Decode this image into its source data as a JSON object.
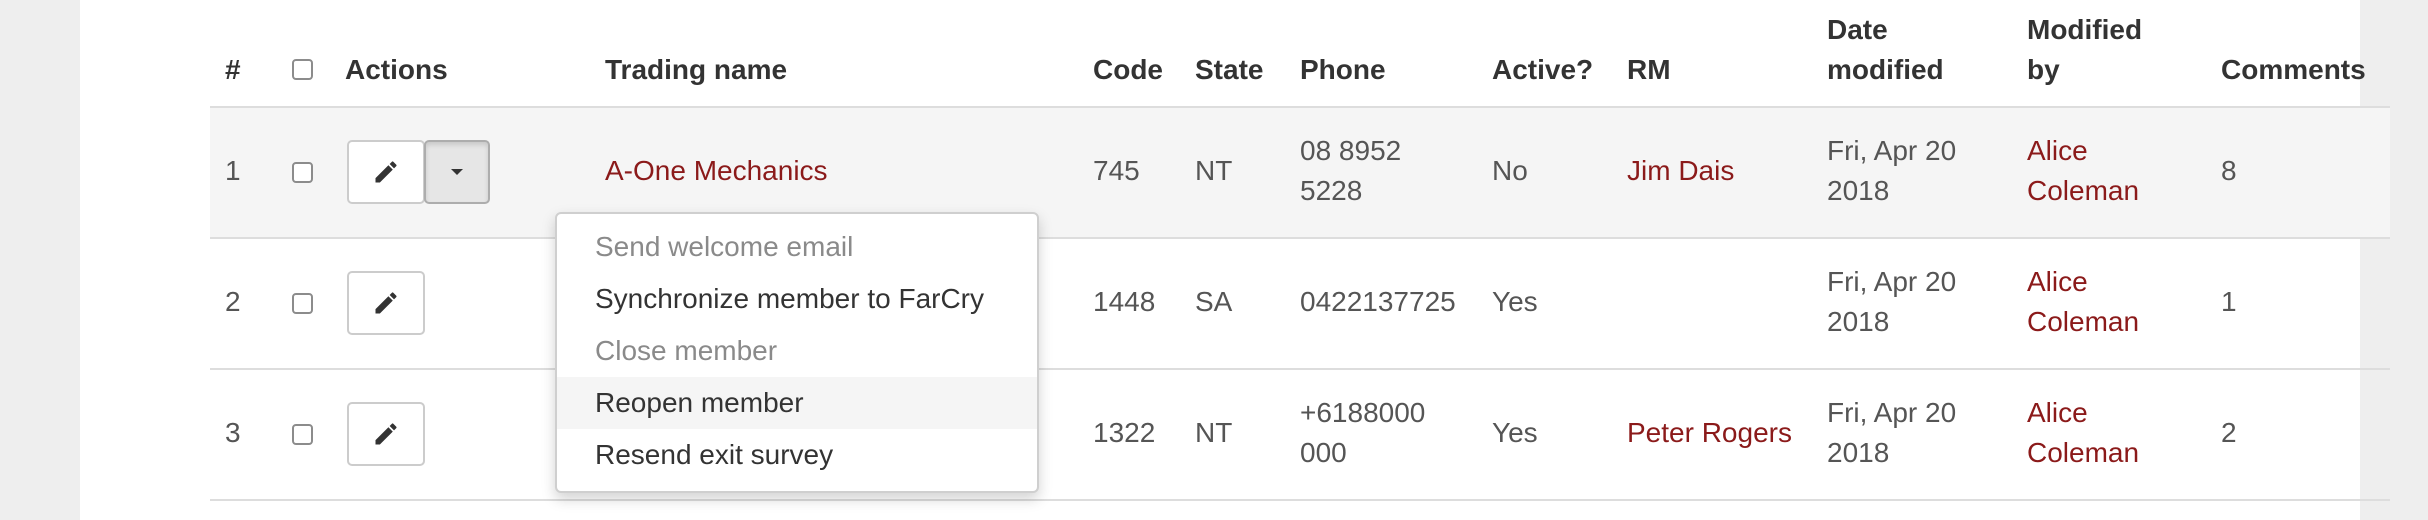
{
  "colors": {
    "link": "#8b1a1a",
    "text": "#555555",
    "header": "#333333",
    "disabled": "#8a8a8a"
  },
  "headers": {
    "num": "#",
    "actions": "Actions",
    "trading_name": "Trading name",
    "code": "Code",
    "state": "State",
    "phone": "Phone",
    "active": "Active?",
    "rm": "RM",
    "date_modified_1": "Date",
    "date_modified_2": "modified",
    "modified_by_1": "Modified",
    "modified_by_2": "by",
    "comments": "Comments"
  },
  "rows": [
    {
      "num": "1",
      "trading_name": "A-One Mechanics",
      "code": "745",
      "state": "NT",
      "phone_1": "08 8952",
      "phone_2": "5228",
      "active": "No",
      "rm": "Jim Dais",
      "date_1": "Fri, Apr 20",
      "date_2": "2018",
      "by_1": "Alice",
      "by_2": "Coleman",
      "comments": "8"
    },
    {
      "num": "2",
      "trading_name": "",
      "code": "1448",
      "state": "SA",
      "phone_1": "0422137725",
      "phone_2": "",
      "active": "Yes",
      "rm": "",
      "date_1": "Fri, Apr 20",
      "date_2": "2018",
      "by_1": "Alice",
      "by_2": "Coleman",
      "comments": "1"
    },
    {
      "num": "3",
      "trading_name": "",
      "code": "1322",
      "state": "NT",
      "phone_1": "+6188000",
      "phone_2": "000",
      "active": "Yes",
      "rm": "Peter Rogers",
      "date_1": "Fri, Apr 20",
      "date_2": "2018",
      "by_1": "Alice",
      "by_2": "Coleman",
      "comments": "2"
    }
  ],
  "icons": {
    "edit": "pencil-icon",
    "caret": "caret-down-icon"
  },
  "dropdown_menu": {
    "items": [
      {
        "label": "Send welcome email",
        "disabled": true
      },
      {
        "label": "Synchronize member to FarCry",
        "disabled": false
      },
      {
        "label": "Close member",
        "disabled": true
      },
      {
        "label": "Reopen member",
        "disabled": false,
        "hovered": true
      },
      {
        "label": "Resend exit survey",
        "disabled": false
      }
    ]
  }
}
